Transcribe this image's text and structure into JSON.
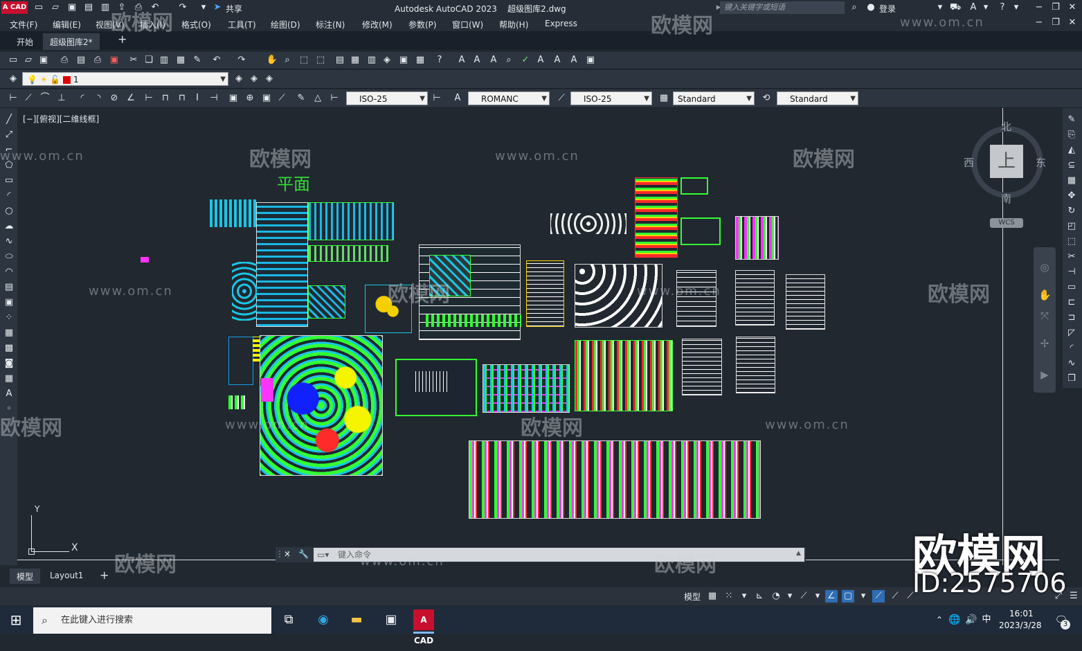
{
  "titlebar": {
    "logo": "A CAD",
    "share": "共享",
    "title": "Autodesk AutoCAD 2023    超级图库2.dwg",
    "search_placeholder": "键入关键字或短语",
    "login": "登录"
  },
  "menu": {
    "items": [
      "文件(F)",
      "编辑(E)",
      "视图(V)",
      "插入(I)",
      "格式(O)",
      "工具(T)",
      "绘图(D)",
      "标注(N)",
      "修改(M)",
      "参数(P)",
      "窗口(W)",
      "帮助(H)",
      "Express"
    ]
  },
  "tabs": {
    "start": "开始",
    "drawing": "超级图库2*",
    "add": "+"
  },
  "layer_toolbar": {
    "current_layer": "1"
  },
  "styles_toolbar": {
    "dim_style": "ISO-25",
    "text_style": "ROMANC",
    "multileader_style": "ISO-25",
    "table_style": "Standard",
    "plot_style": "Standard"
  },
  "canvas": {
    "viewport_label": "[−][俯视][二维线框]",
    "plan_label": "平面"
  },
  "viewcube": {
    "face": "上",
    "north": "北",
    "south": "南",
    "east": "东",
    "west": "西",
    "wcs": "WCS"
  },
  "ucs": {
    "x": "X",
    "y": "Y"
  },
  "command": {
    "placeholder": "键入命令"
  },
  "layout_tabs": {
    "model": "模型",
    "layout1": "Layout1",
    "add": "+"
  },
  "statusbar": {
    "model": "模型"
  },
  "taskbar": {
    "search_placeholder": "在此键入进行搜索",
    "autocad_label": "A CAD",
    "ime": "中",
    "time": "16:01",
    "date": "2023/3/28",
    "notifications": "3"
  },
  "watermark": {
    "brand": "欧模网",
    "url": "www.om.cn",
    "id": "ID:2575706"
  },
  "colors": {
    "background": "#212830",
    "accent_green": "#33dd33",
    "autocad_red": "#c8102e"
  }
}
